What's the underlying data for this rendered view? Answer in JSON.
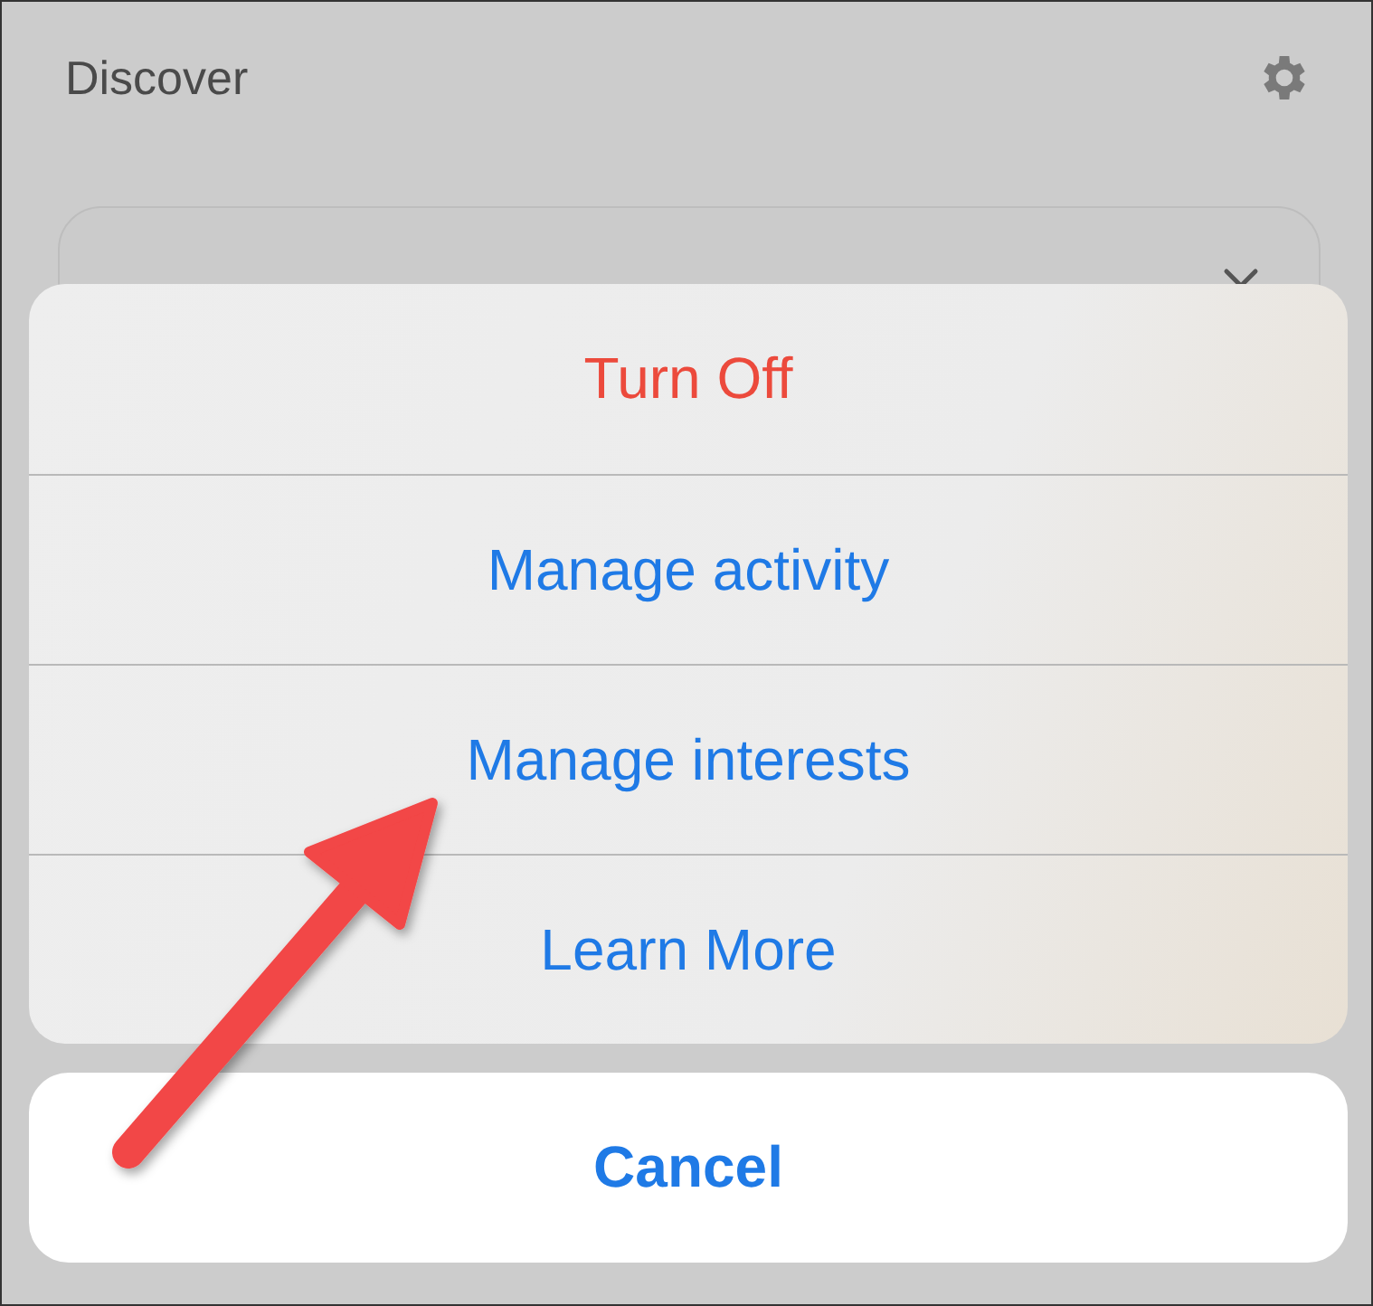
{
  "header": {
    "title": "Discover"
  },
  "action_sheet": {
    "actions": [
      {
        "label": "Turn Off",
        "kind": "destructive"
      },
      {
        "label": "Manage activity",
        "kind": "default"
      },
      {
        "label": "Manage interests",
        "kind": "default"
      },
      {
        "label": "Learn More",
        "kind": "default"
      }
    ],
    "cancel": "Cancel"
  }
}
